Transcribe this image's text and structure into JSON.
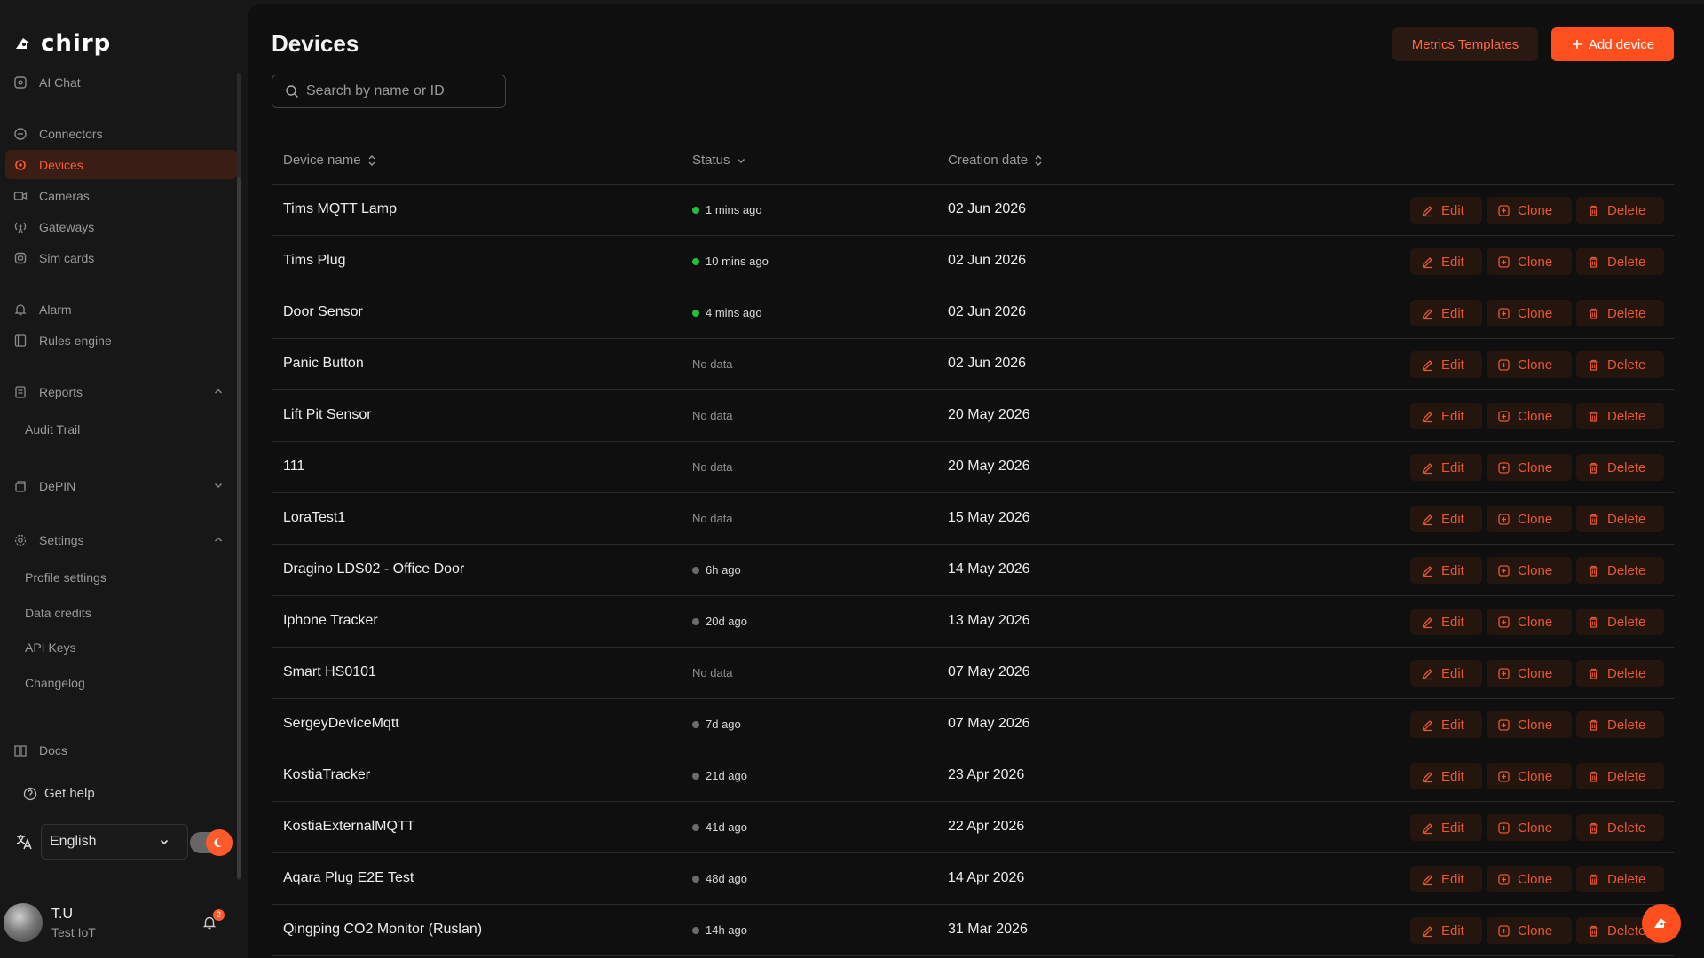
{
  "app": {
    "name": "chirp"
  },
  "sidebar": {
    "items": [
      {
        "key": "ai-chat",
        "label": "AI Chat",
        "icon": "chat-shield-icon"
      },
      {
        "key": "connectors",
        "label": "Connectors",
        "icon": "connectors-icon"
      },
      {
        "key": "devices",
        "label": "Devices",
        "icon": "devices-icon"
      },
      {
        "key": "cameras",
        "label": "Cameras",
        "icon": "camera-icon"
      },
      {
        "key": "gateways",
        "label": "Gateways",
        "icon": "antenna-icon"
      },
      {
        "key": "sim-cards",
        "label": "Sim cards",
        "icon": "sim-card-icon"
      },
      {
        "key": "alarm",
        "label": "Alarm",
        "icon": "bell-icon"
      },
      {
        "key": "rules-engine",
        "label": "Rules engine",
        "icon": "rules-icon"
      },
      {
        "key": "reports",
        "label": "Reports",
        "icon": "report-icon"
      },
      {
        "key": "depin",
        "label": "DePIN",
        "icon": "depin-icon"
      },
      {
        "key": "settings",
        "label": "Settings",
        "icon": "gear-icon"
      },
      {
        "key": "docs",
        "label": "Docs",
        "icon": "book-icon"
      }
    ],
    "active": "Devices",
    "reports_sub": [
      "Audit Trail"
    ],
    "settings_sub": [
      "Profile settings",
      "Data credits",
      "API Keys",
      "Changelog"
    ],
    "get_help": "Get help",
    "language": "English",
    "user": {
      "initials": "T.U",
      "org": "Test IoT"
    },
    "notifications": "2"
  },
  "main": {
    "title": "Devices",
    "metrics_templates": "Metrics Templates",
    "add_device": "Add device",
    "search_placeholder": "Search by name or ID",
    "columns": {
      "name": "Device name",
      "status": "Status",
      "created": "Creation date"
    },
    "actions": {
      "edit": "Edit",
      "clone": "Clone",
      "delete": "Delete"
    },
    "colors": {
      "online": "#1fc13a",
      "offline": "#6b6b6b",
      "accent": "#ff4f1f"
    },
    "devices": [
      {
        "name": "Tims MQTT Lamp",
        "status": "1 mins ago",
        "state": "online",
        "created": "02 Jun 2026"
      },
      {
        "name": "Tims Plug",
        "status": "10 mins ago",
        "state": "online",
        "created": "02 Jun 2026"
      },
      {
        "name": "Door Sensor",
        "status": "4 mins ago",
        "state": "online",
        "created": "02 Jun 2026"
      },
      {
        "name": "Panic Button",
        "status": "No data",
        "state": "none",
        "created": "02 Jun 2026"
      },
      {
        "name": "Lift Pit Sensor",
        "status": "No data",
        "state": "none",
        "created": "20 May 2026"
      },
      {
        "name": "111",
        "status": "No data",
        "state": "none",
        "created": "20 May 2026"
      },
      {
        "name": "LoraTest1",
        "status": "No data",
        "state": "none",
        "created": "15 May 2026"
      },
      {
        "name": "Dragino LDS02 - Office Door",
        "status": "6h ago",
        "state": "offline",
        "created": "14 May 2026"
      },
      {
        "name": "Iphone Tracker",
        "status": "20d ago",
        "state": "offline",
        "created": "13 May 2026"
      },
      {
        "name": "Smart HS0101",
        "status": "No data",
        "state": "none",
        "created": "07 May 2026"
      },
      {
        "name": "SergeyDeviceMqtt",
        "status": "7d ago",
        "state": "offline",
        "created": "07 May 2026"
      },
      {
        "name": "KostiaTracker",
        "status": "21d ago",
        "state": "offline",
        "created": "23 Apr 2026"
      },
      {
        "name": "KostiaExternalMQTT",
        "status": "41d ago",
        "state": "offline",
        "created": "22 Apr 2026"
      },
      {
        "name": "Aqara Plug E2E Test",
        "status": "48d ago",
        "state": "offline",
        "created": "14 Apr 2026"
      },
      {
        "name": "Qingping CO2 Monitor (Ruslan)",
        "status": "14h ago",
        "state": "offline",
        "created": "31 Mar 2026"
      }
    ]
  }
}
